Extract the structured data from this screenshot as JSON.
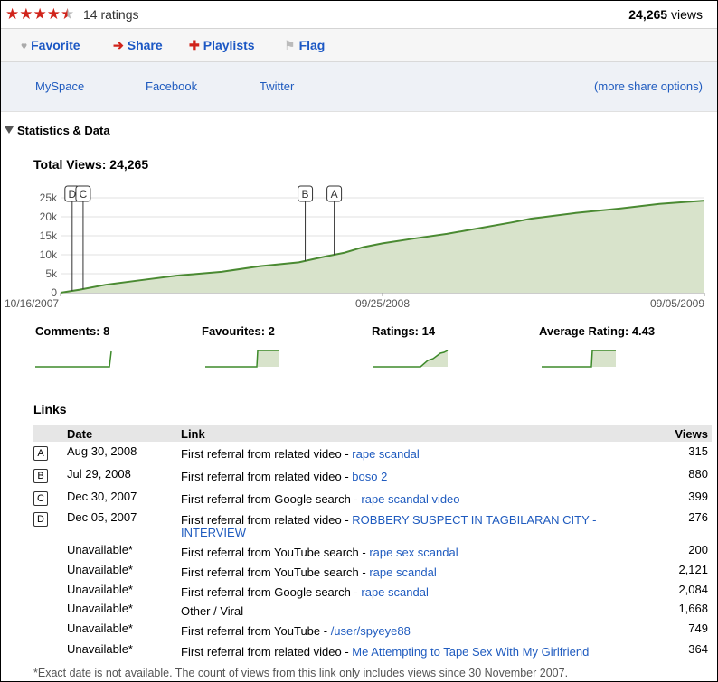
{
  "rating": {
    "stars_filled": 4.5,
    "ratings_text": "14 ratings"
  },
  "views_top": {
    "count": "24,265",
    "label": "views"
  },
  "actions": [
    {
      "label": "Favorite",
      "icon": "heart-icon"
    },
    {
      "label": "Share",
      "icon": "arrow-right-icon"
    },
    {
      "label": "Playlists",
      "icon": "plus-icon"
    },
    {
      "label": "Flag",
      "icon": "flag-icon"
    }
  ],
  "share_links": {
    "myspace": "MySpace",
    "facebook": "Facebook",
    "twitter": "Twitter",
    "more": "(more share options)"
  },
  "stats": {
    "title": "Statistics & Data",
    "total_views": "Total Views: 24,265",
    "comments": "Comments: 8",
    "favourites": "Favourites: 2",
    "ratings": "Ratings: 14",
    "avg_rating": "Average Rating: 4.43"
  },
  "chart_data": {
    "type": "area",
    "x_ticks": [
      "10/16/2007",
      "09/25/2008",
      "09/05/2009"
    ],
    "y_ticks": [
      "0",
      "5k",
      "10k",
      "15k",
      "20k",
      "25k"
    ],
    "ylim": [
      0,
      25000
    ],
    "x": [
      0,
      0.03,
      0.07,
      0.12,
      0.18,
      0.25,
      0.31,
      0.37,
      0.41,
      0.44,
      0.47,
      0.5,
      0.55,
      0.6,
      0.65,
      0.7,
      0.73,
      0.8,
      0.87,
      0.93,
      1.0
    ],
    "y": [
      0,
      800,
      2100,
      3200,
      4500,
      5500,
      7000,
      8000,
      9500,
      10500,
      12000,
      13000,
      14300,
      15500,
      17000,
      18500,
      19500,
      21000,
      22200,
      23400,
      24265
    ],
    "markers": [
      {
        "label": "D",
        "x": 0.018
      },
      {
        "label": "C",
        "x": 0.035
      },
      {
        "label": "B",
        "x": 0.38
      },
      {
        "label": "A",
        "x": 0.425
      }
    ],
    "grid": true,
    "fill_color": "#d8e3cb",
    "line_color": "#4a8a32"
  },
  "links": {
    "title": "Links",
    "headers": {
      "date": "Date",
      "link": "Link",
      "views": "Views"
    },
    "rows": [
      {
        "marker": "A",
        "date": "Aug 30, 2008",
        "prefix": "First referral from related video - ",
        "link": "rape scandal",
        "views": "315"
      },
      {
        "marker": "B",
        "date": "Jul 29, 2008",
        "prefix": "First referral from related video - ",
        "link": "boso 2",
        "views": "880"
      },
      {
        "marker": "C",
        "date": "Dec 30, 2007",
        "prefix": "First referral from Google search - ",
        "link": "rape scandal video",
        "views": "399"
      },
      {
        "marker": "D",
        "date": "Dec 05, 2007",
        "prefix": "First referral from related video - ",
        "link": "ROBBERY SUSPECT IN TAGBILARAN CITY -",
        "link2": "INTERVIEW",
        "views": "276"
      },
      {
        "marker": "",
        "date": "Unavailable*",
        "prefix": "First referral from YouTube search - ",
        "link": "rape sex scandal",
        "views": "200"
      },
      {
        "marker": "",
        "date": "Unavailable*",
        "prefix": "First referral from YouTube search - ",
        "link": "rape scandal",
        "views": "2,121"
      },
      {
        "marker": "",
        "date": "Unavailable*",
        "prefix": "First referral from Google search - ",
        "link": "rape scandal",
        "views": "2,084"
      },
      {
        "marker": "",
        "date": "Unavailable*",
        "prefix": "Other / Viral",
        "link": "",
        "views": "1,668"
      },
      {
        "marker": "",
        "date": "Unavailable*",
        "prefix": "First referral from YouTube - ",
        "link": "/user/spyeye88",
        "views": "749"
      },
      {
        "marker": "",
        "date": "Unavailable*",
        "prefix": "First referral from related video - ",
        "link": "Me Attempting to Tape Sex With My Girlfriend",
        "views": "364"
      }
    ],
    "footnote": "*Exact date is not available. The count of views from this link only includes views since 30 November 2007."
  }
}
